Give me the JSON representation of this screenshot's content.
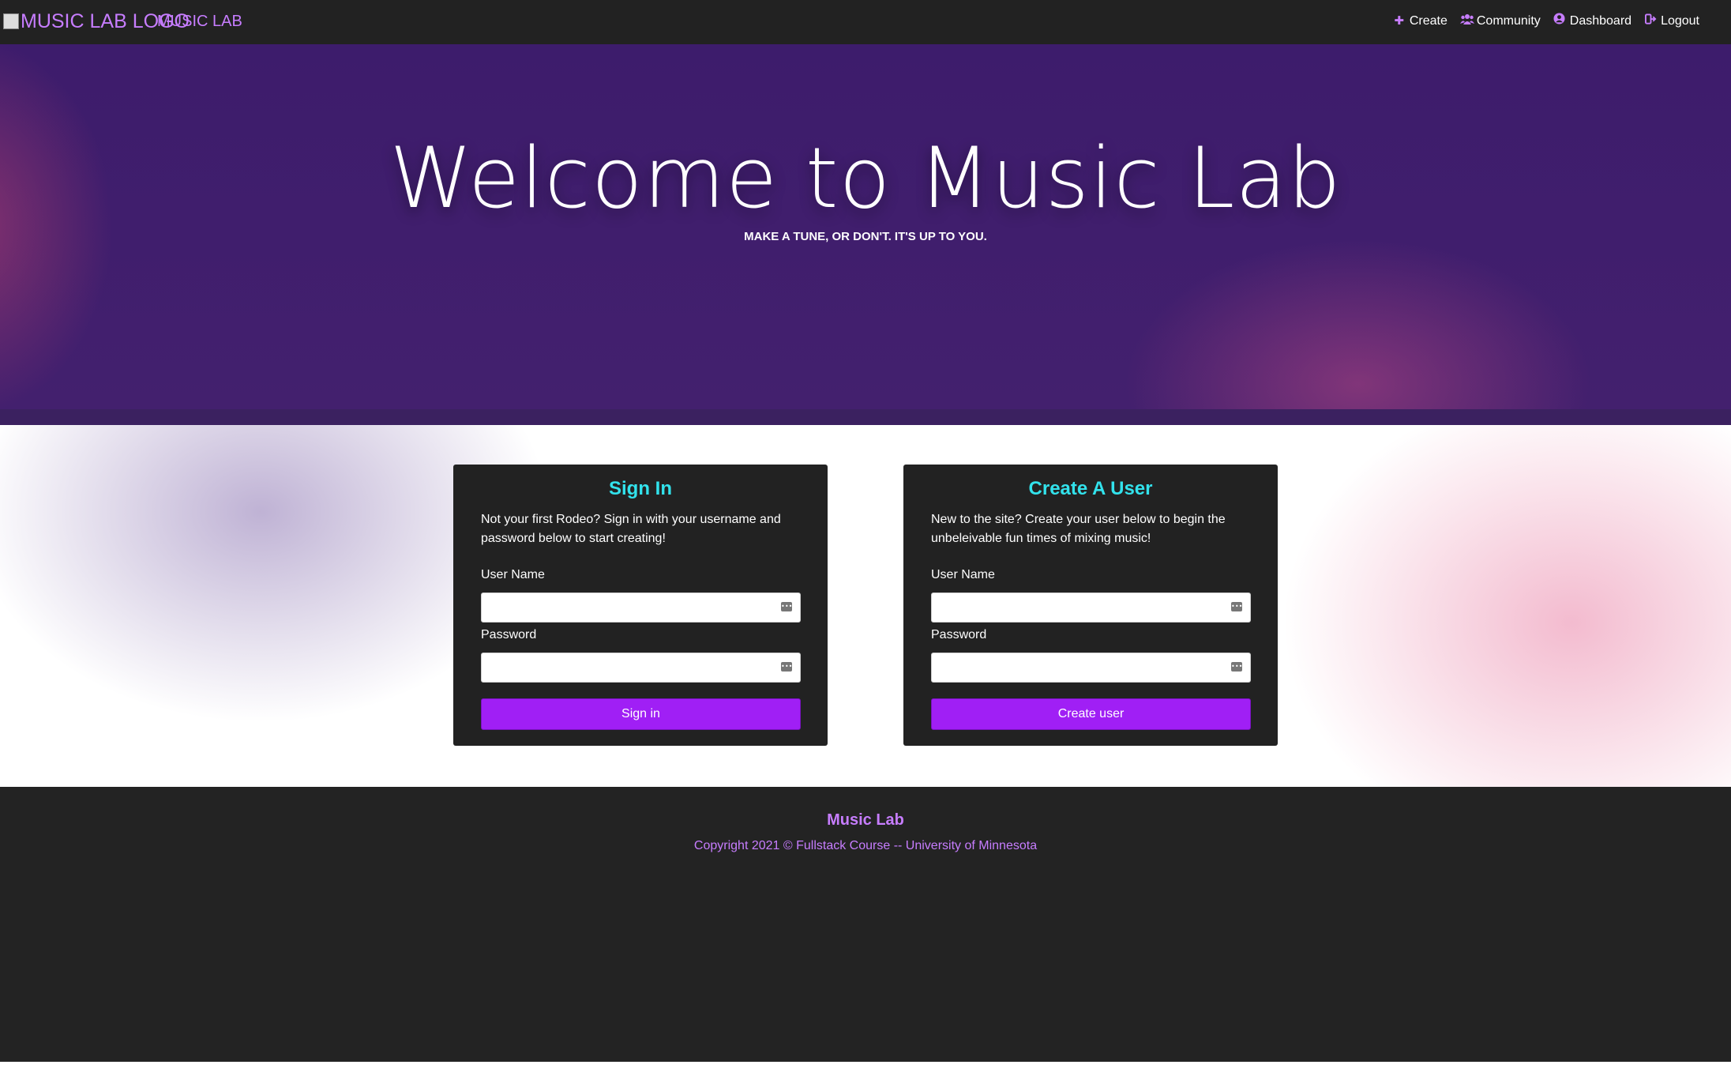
{
  "navbar": {
    "logo_alt": "MUSIC LAB LOGO",
    "brand": "MUSIC LAB",
    "links": [
      {
        "label": "Create",
        "icon": "plus-icon"
      },
      {
        "label": "Community",
        "icon": "users-icon"
      },
      {
        "label": "Dashboard",
        "icon": "user-circle-icon"
      },
      {
        "label": "Logout",
        "icon": "logout-icon"
      }
    ]
  },
  "hero": {
    "title": "Welcome to Music Lab",
    "subtitle": "MAKE A TUNE, OR DON'T. IT'S UP TO YOU."
  },
  "signin": {
    "title": "Sign In",
    "description": "Not your first Rodeo? Sign in with your username and password below to start creating!",
    "username_label": "User Name",
    "password_label": "Password",
    "button": "Sign in"
  },
  "signup": {
    "title": "Create A User",
    "description": "New to the site? Create your user below to begin the unbeleivable fun times of mixing music!",
    "username_label": "User Name",
    "password_label": "Password",
    "button": "Create user"
  },
  "footer": {
    "title": "Music Lab",
    "copyright": "Copyright 2021 © Fullstack Course -- University of Minnesota"
  },
  "colors": {
    "accent": "#c77dff",
    "heading": "#32e2ec",
    "button": "#a01ff5",
    "dark": "#222222",
    "hero": "#3d1c6c"
  }
}
